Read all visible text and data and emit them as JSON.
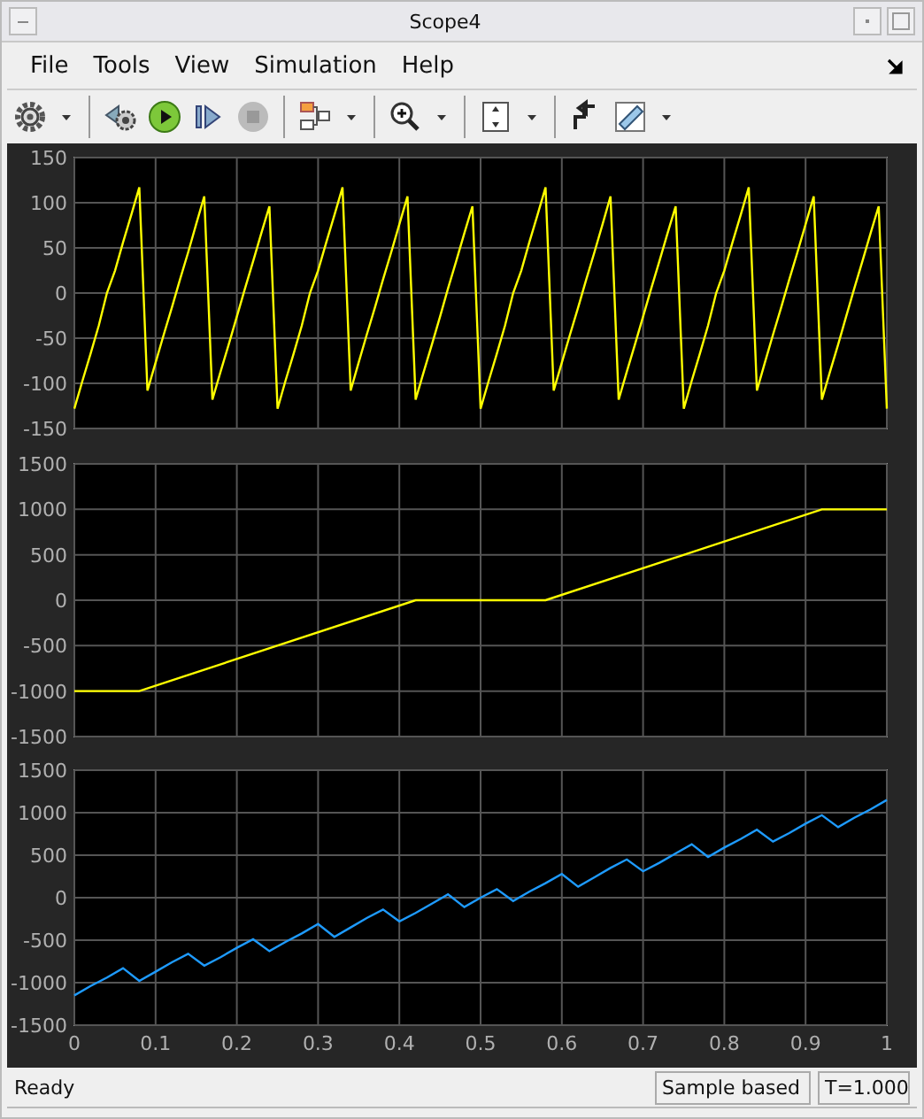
{
  "window": {
    "title": "Scope4"
  },
  "menu": [
    "File",
    "Tools",
    "View",
    "Simulation",
    "Help"
  ],
  "stop_button": {
    "disabled": true
  },
  "plots": [
    {
      "chart_data": {
        "type": "line",
        "x": [
          0,
          0.01,
          0.02,
          0.03,
          0.04,
          0.05,
          0.06,
          0.07,
          0.08,
          0.09,
          0.1,
          0.11,
          0.12,
          0.13,
          0.14,
          0.15,
          0.16,
          0.17,
          0.18,
          0.19,
          0.2,
          0.21,
          0.22,
          0.23,
          0.24,
          0.25,
          0.26,
          0.27,
          0.28,
          0.29,
          0.3,
          0.31,
          0.32,
          0.33,
          0.34,
          0.35,
          0.36,
          0.37,
          0.38,
          0.39,
          0.4,
          0.41,
          0.42,
          0.43,
          0.44,
          0.45,
          0.46,
          0.47,
          0.48,
          0.49,
          0.5,
          0.51,
          0.52,
          0.53,
          0.54,
          0.55,
          0.56,
          0.57,
          0.58,
          0.59,
          0.6,
          0.61,
          0.62,
          0.63,
          0.64,
          0.65,
          0.66,
          0.67,
          0.68,
          0.69,
          0.7,
          0.71,
          0.72,
          0.73,
          0.74,
          0.75,
          0.76,
          0.77,
          0.78,
          0.79,
          0.8,
          0.81,
          0.82,
          0.83,
          0.84,
          0.85,
          0.86,
          0.87,
          0.88,
          0.89,
          0.9,
          0.91,
          0.92,
          0.93,
          0.94,
          0.95,
          0.96,
          0.97,
          0.98,
          0.99,
          1
        ],
        "series": [
          {
            "color": "#ffff00",
            "values": [
              -128,
              -97,
              -67,
              -36,
              0,
              25,
              56,
              86,
              117,
              -108,
              -77,
              -46,
              -16,
              15,
              45,
              76,
              107,
              -118,
              -87,
              -57,
              -26,
              5,
              35,
              66,
              96,
              -128,
              -97,
              -67,
              -36,
              0,
              25,
              56,
              86,
              117,
              -108,
              -77,
              -46,
              -16,
              15,
              45,
              76,
              107,
              -118,
              -87,
              -57,
              -26,
              5,
              35,
              66,
              96,
              -128,
              -97,
              -67,
              -36,
              0,
              25,
              56,
              86,
              117,
              -108,
              -77,
              -46,
              -16,
              15,
              45,
              76,
              107,
              -118,
              -87,
              -57,
              -26,
              5,
              35,
              66,
              96,
              -128,
              -97,
              -67,
              -36,
              0,
              25,
              56,
              86,
              117,
              -108,
              -77,
              -46,
              -16,
              15,
              45,
              76,
              107,
              -118,
              -87,
              -57,
              -26,
              5,
              35,
              66,
              96,
              -128
            ]
          }
        ],
        "xlim": [
          0,
          1
        ],
        "ylim": [
          -150,
          150
        ],
        "grid": true,
        "yticks": [
          -150,
          -100,
          -50,
          0,
          50,
          100,
          150
        ]
      }
    },
    {
      "chart_data": {
        "type": "line",
        "x": [
          0,
          0.08,
          0.42,
          0.58,
          0.92,
          1
        ],
        "series": [
          {
            "color": "#ffff00",
            "values": [
              -1000,
              -1000,
              0,
              0,
              1000,
              1000
            ]
          }
        ],
        "xlim": [
          0,
          1
        ],
        "ylim": [
          -1500,
          1500
        ],
        "grid": true,
        "yticks": [
          -1500,
          -1000,
          -500,
          0,
          500,
          1000,
          1500
        ]
      }
    },
    {
      "chart_data": {
        "type": "line",
        "x": [
          0,
          0.02,
          0.04,
          0.06,
          0.08,
          0.1,
          0.12,
          0.14,
          0.16,
          0.18,
          0.2,
          0.22,
          0.24,
          0.26,
          0.28,
          0.3,
          0.32,
          0.34,
          0.36,
          0.38,
          0.4,
          0.42,
          0.44,
          0.46,
          0.48,
          0.5,
          0.52,
          0.54,
          0.56,
          0.58,
          0.6,
          0.62,
          0.64,
          0.66,
          0.68,
          0.7,
          0.72,
          0.74,
          0.76,
          0.78,
          0.8,
          0.82,
          0.84,
          0.86,
          0.88,
          0.9,
          0.92,
          0.94,
          0.96,
          0.98,
          1
        ],
        "series": [
          {
            "color": "#1e9bff",
            "values": [
              -1150,
              -1040,
              -940,
              -830,
              -980,
              -870,
              -760,
              -660,
              -800,
              -700,
              -590,
              -490,
              -630,
              -520,
              -420,
              -310,
              -460,
              -350,
              -240,
              -140,
              -280,
              -180,
              -70,
              40,
              -110,
              0,
              100,
              -40,
              70,
              170,
              280,
              130,
              240,
              350,
              450,
              310,
              410,
              520,
              630,
              480,
              590,
              690,
              800,
              660,
              760,
              870,
              970,
              830,
              940,
              1040,
              1150
            ]
          }
        ],
        "xlim": [
          0,
          1
        ],
        "ylim": [
          -1500,
          1500
        ],
        "grid": true,
        "yticks": [
          -1500,
          -1000,
          -500,
          0,
          500,
          1000,
          1500
        ],
        "xticks": [
          0,
          0.1,
          0.2,
          0.3,
          0.4,
          0.5,
          0.6,
          0.7,
          0.8,
          0.9,
          1
        ]
      }
    }
  ],
  "status_bar": {
    "message": "Ready",
    "mode": "Sample based",
    "time": "T=1.000"
  }
}
